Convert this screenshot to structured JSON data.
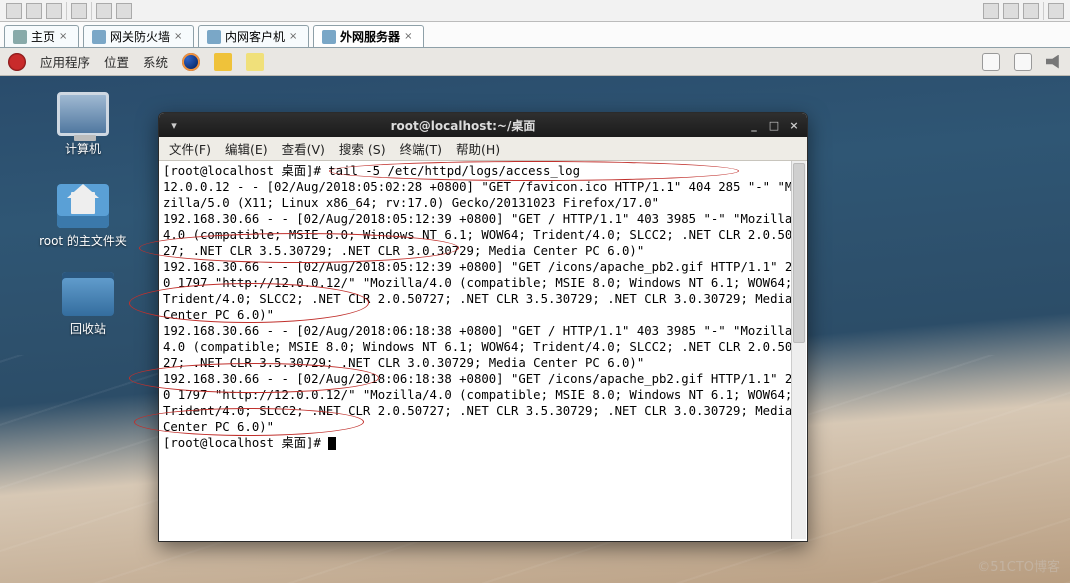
{
  "tabs": {
    "home": "主页",
    "fw": "网关防火墙",
    "clnt": "内网客户机",
    "ext": "外网服务器"
  },
  "panel": {
    "apps": "应用程序",
    "places": "位置",
    "system": "系统"
  },
  "desktop_icons": {
    "computer": "计算机",
    "home": "root 的主文件夹",
    "trash": "回收站"
  },
  "terminal": {
    "title": "root@localhost:~/桌面",
    "menu": {
      "file": "文件(F)",
      "edit": "编辑(E)",
      "view": "查看(V)",
      "search": "搜索 (S)",
      "terminal": "终端(T)",
      "help": "帮助(H)"
    },
    "lines": [
      "[root@localhost 桌面]# tail -5 /etc/httpd/logs/access_log",
      "12.0.0.12 - - [02/Aug/2018:05:02:28 +0800] \"GET /favicon.ico HTTP/1.1\" 404 285 \"-\" \"Mozilla/5.0 (X11; Linux x86_64; rv:17.0) Gecko/20131023 Firefox/17.0\"",
      "192.168.30.66 - - [02/Aug/2018:05:12:39 +0800] \"GET / HTTP/1.1\" 403 3985 \"-\" \"Mozilla/4.0 (compatible; MSIE 8.0; Windows NT 6.1; WOW64; Trident/4.0; SLCC2; .NET CLR 2.0.50727; .NET CLR 3.5.30729; .NET CLR 3.0.30729; Media Center PC 6.0)\"",
      "192.168.30.66 - - [02/Aug/2018:05:12:39 +0800] \"GET /icons/apache_pb2.gif HTTP/1.1\" 200 1797 \"http://12.0.0.12/\" \"Mozilla/4.0 (compatible; MSIE 8.0; Windows NT 6.1; WOW64; Trident/4.0; SLCC2; .NET CLR 2.0.50727; .NET CLR 3.5.30729; .NET CLR 3.0.30729; Media Center PC 6.0)\"",
      "192.168.30.66 - - [02/Aug/2018:06:18:38 +0800] \"GET / HTTP/1.1\" 403 3985 \"-\" \"Mozilla/4.0 (compatible; MSIE 8.0; Windows NT 6.1; WOW64; Trident/4.0; SLCC2; .NET CLR 2.0.50727; .NET CLR 3.5.30729; .NET CLR 3.0.30729; Media Center PC 6.0)\"",
      "192.168.30.66 - - [02/Aug/2018:06:18:38 +0800] \"GET /icons/apache_pb2.gif HTTP/1.1\" 200 1797 \"http://12.0.0.12/\" \"Mozilla/4.0 (compatible; MSIE 8.0; Windows NT 6.1; WOW64; Trident/4.0; SLCC2; .NET CLR 2.0.50727; .NET CLR 3.5.30729; .NET CLR 3.0.30729; Media Center PC 6.0)\"",
      "[root@localhost 桌面]# "
    ]
  },
  "watermark": "©51CTO博客"
}
